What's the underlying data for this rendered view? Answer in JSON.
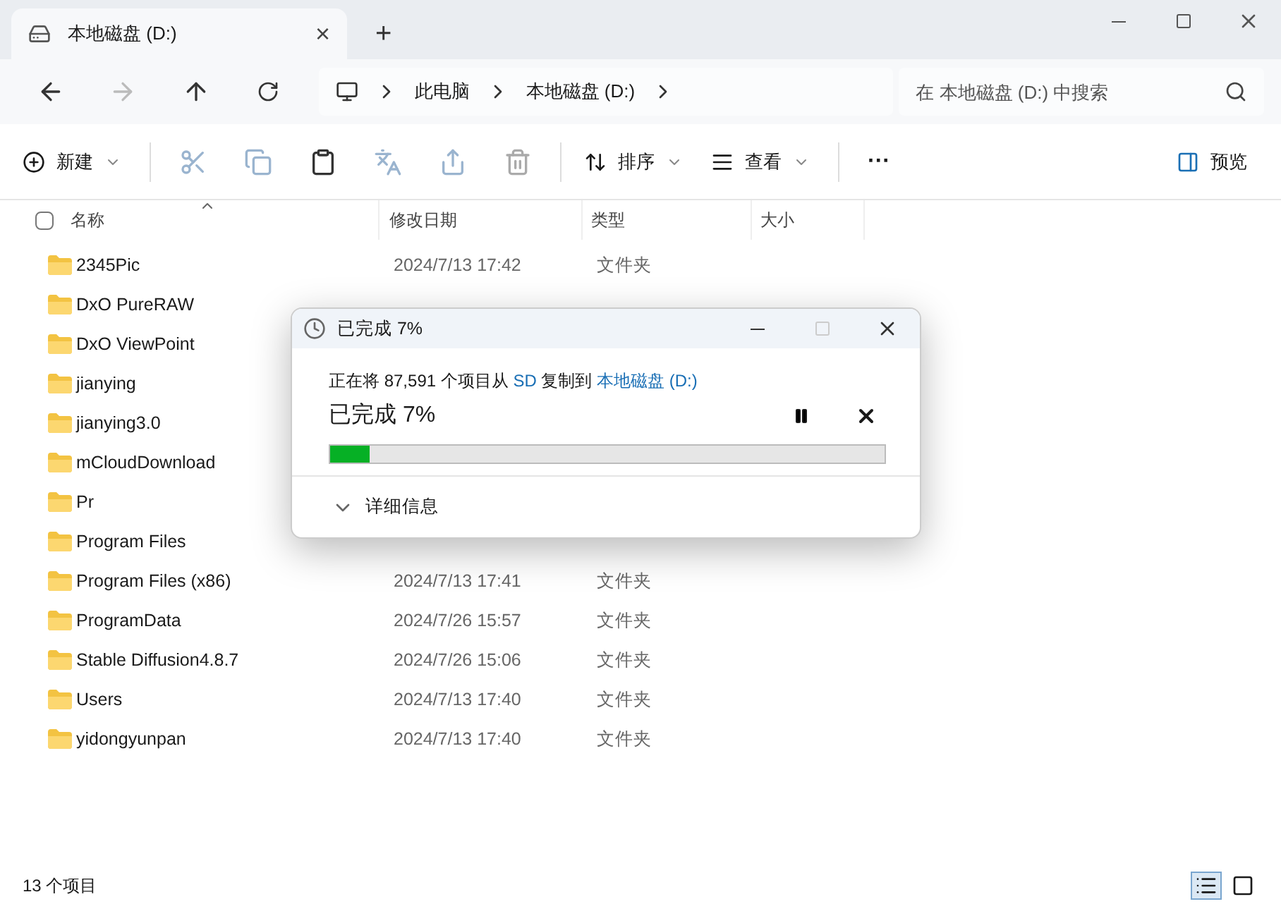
{
  "tab": {
    "title": "本地磁盘 (D:)",
    "close": "×",
    "new": "+"
  },
  "address": {
    "crumbs": [
      "此电脑",
      "本地磁盘 (D:)"
    ]
  },
  "search": {
    "placeholder": "在 本地磁盘 (D:) 中搜索"
  },
  "toolbar": {
    "new": "新建",
    "sort": "排序",
    "view": "查看",
    "more": "···",
    "preview": "预览"
  },
  "select_all": {
    "checked": false
  },
  "columns": [
    "名称",
    "修改日期",
    "类型",
    "大小"
  ],
  "rows": [
    {
      "name": "2345Pic",
      "date": "2024/7/13 17:42",
      "type": "文件夹"
    },
    {
      "name": "DxO PureRAW"
    },
    {
      "name": "DxO ViewPoint"
    },
    {
      "name": "jianying"
    },
    {
      "name": "jianying3.0"
    },
    {
      "name": "mCloudDownload"
    },
    {
      "name": "Pr"
    },
    {
      "name": "Program Files"
    },
    {
      "name": "Program Files (x86)",
      "date": "2024/7/13 17:41",
      "type": "文件夹"
    },
    {
      "name": "ProgramData",
      "date": "2024/7/26 15:57",
      "type": "文件夹"
    },
    {
      "name": "Stable Diffusion4.8.7",
      "date": "2024/7/26 15:06",
      "type": "文件夹"
    },
    {
      "name": "Users",
      "date": "2024/7/13 17:40",
      "type": "文件夹"
    },
    {
      "name": "yidongyunpan",
      "date": "2024/7/13 17:40",
      "type": "文件夹"
    }
  ],
  "status_bar": {
    "count": "13 个项目",
    "views": [
      {
        "kind": "details",
        "selected": true
      },
      {
        "kind": "tiles",
        "selected": false
      }
    ]
  },
  "dialog": {
    "title": "已完成 7%",
    "message": "正在将 87,591 个项目从 **SD** 复制到 **本地磁盘 (D:)**",
    "progress_text": "已完成 7%",
    "level": 0.07,
    "details": "详细信息"
  }
}
